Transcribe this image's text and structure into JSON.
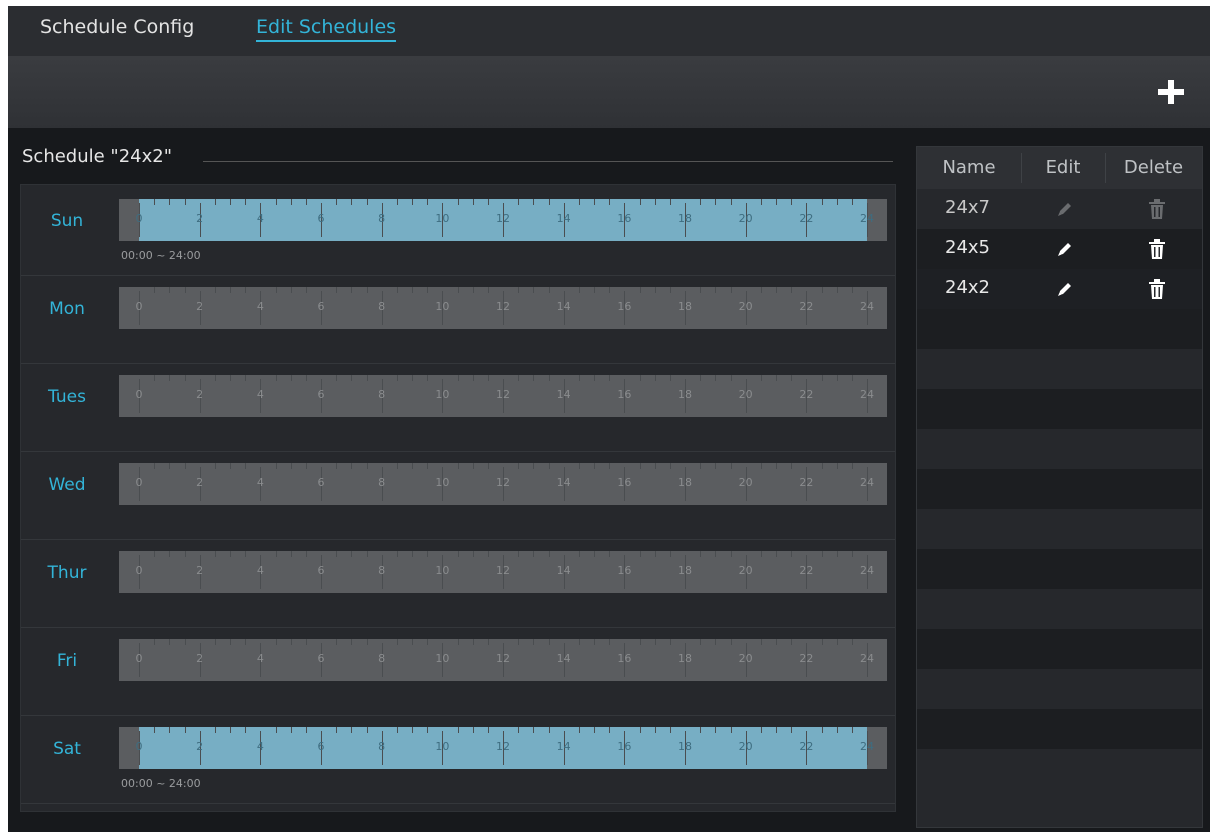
{
  "tabs": {
    "config": "Schedule Config",
    "edit": "Edit Schedules"
  },
  "toolbar": {
    "add_icon": "plus-icon"
  },
  "schedule": {
    "title": "Schedule \"24x2\"",
    "hour_labels": [
      "0",
      "2",
      "4",
      "6",
      "8",
      "10",
      "12",
      "14",
      "16",
      "18",
      "20",
      "22",
      "24"
    ],
    "days": [
      {
        "label": "Sun",
        "range": "00:00 ~ 24:00",
        "active": true
      },
      {
        "label": "Mon",
        "range": "",
        "active": false
      },
      {
        "label": "Tues",
        "range": "",
        "active": false
      },
      {
        "label": "Wed",
        "range": "",
        "active": false
      },
      {
        "label": "Thur",
        "range": "",
        "active": false
      },
      {
        "label": "Fri",
        "range": "",
        "active": false
      },
      {
        "label": "Sat",
        "range": "00:00 ~ 24:00",
        "active": true
      }
    ]
  },
  "list": {
    "headers": {
      "name": "Name",
      "edit": "Edit",
      "delete": "Delete"
    },
    "rows": [
      {
        "name": "24x7",
        "enabled": false
      },
      {
        "name": "24x5",
        "enabled": true
      },
      {
        "name": "24x2",
        "enabled": true,
        "selected": true
      }
    ]
  },
  "colors": {
    "accent": "#33b4d8",
    "active_fill": "#77aec4",
    "inactive_fill": "#5b5d60"
  }
}
